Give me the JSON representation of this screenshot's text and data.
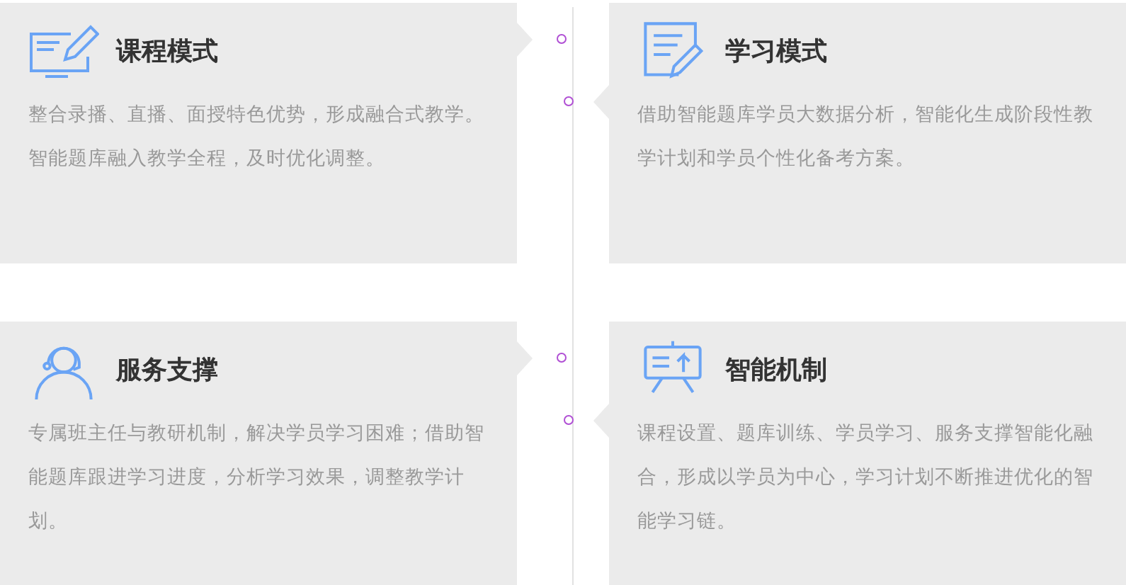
{
  "rows": [
    {
      "left": {
        "kind": "monitor",
        "title": "课程模式",
        "paragraphs": [
          "整合录播、直播、面授特色优势，形成融合式教学。",
          "智能题库融入教学全程，及时优化调整。"
        ]
      },
      "right": {
        "kind": "document",
        "title": "学习模式",
        "paragraphs": [
          "借助智能题库学员大数据分析，智能化生成阶段性教学计划和学员个性化备考方案。"
        ]
      }
    },
    {
      "left": {
        "kind": "headset",
        "title": "服务支撑",
        "paragraphs": [
          "专属班主任与教研机制，解决学员学习困难；借助智能题库跟进学习进度，分析学习效果，调整教学计划。"
        ]
      },
      "right": {
        "kind": "board",
        "title": "智能机制",
        "paragraphs": [
          "课程设置、题库训练、学员学习、服务支撑智能化融合，形成以学员为中心，学习计划不断推进优化的智能学习链。"
        ]
      }
    }
  ]
}
